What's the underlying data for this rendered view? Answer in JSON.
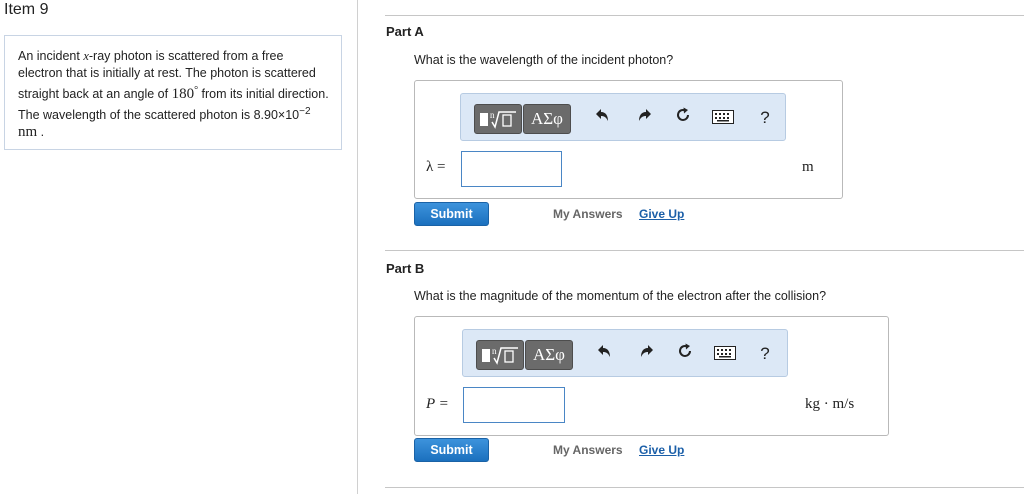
{
  "item_title": "Item 9",
  "problem": {
    "t1": "An incident ",
    "x": "x",
    "t2": "-ray photon is scattered from a free electron that is initially at rest. The photon is scattered straight back at an angle of ",
    "angle": "180",
    "deg": "°",
    "t3": " from its initial direction. The wavelength of the scattered photon is 8.90×10",
    "exp": "−2",
    "t4": " nm",
    "t5": " ."
  },
  "toolbar": {
    "greek_label": "ΑΣφ",
    "help_label": "?"
  },
  "parts": [
    {
      "label": "Part A",
      "question": "What is the wavelength of the incident photon?",
      "var_label": "λ =",
      "unit": "m",
      "input_value": "",
      "submit_label": "Submit",
      "my_answers_label": "My Answers",
      "give_up_label": "Give Up"
    },
    {
      "label": "Part B",
      "question": "What is the magnitude of the momentum of the electron after the collision?",
      "var_label": "P =",
      "unit": "kg · m/s",
      "input_value": "",
      "submit_label": "Submit",
      "my_answers_label": "My Answers",
      "give_up_label": "Give Up"
    }
  ]
}
